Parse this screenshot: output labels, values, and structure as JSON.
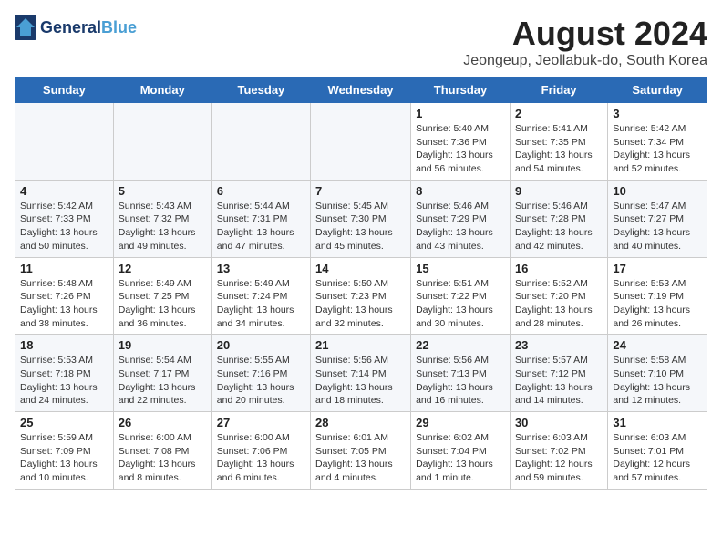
{
  "header": {
    "logo_line1": "General",
    "logo_line2": "Blue",
    "month_year": "August 2024",
    "location": "Jeongeup, Jeollabuk-do, South Korea"
  },
  "days_of_week": [
    "Sunday",
    "Monday",
    "Tuesday",
    "Wednesday",
    "Thursday",
    "Friday",
    "Saturday"
  ],
  "weeks": [
    [
      {
        "day": "",
        "info": ""
      },
      {
        "day": "",
        "info": ""
      },
      {
        "day": "",
        "info": ""
      },
      {
        "day": "",
        "info": ""
      },
      {
        "day": "1",
        "info": "Sunrise: 5:40 AM\nSunset: 7:36 PM\nDaylight: 13 hours\nand 56 minutes."
      },
      {
        "day": "2",
        "info": "Sunrise: 5:41 AM\nSunset: 7:35 PM\nDaylight: 13 hours\nand 54 minutes."
      },
      {
        "day": "3",
        "info": "Sunrise: 5:42 AM\nSunset: 7:34 PM\nDaylight: 13 hours\nand 52 minutes."
      }
    ],
    [
      {
        "day": "4",
        "info": "Sunrise: 5:42 AM\nSunset: 7:33 PM\nDaylight: 13 hours\nand 50 minutes."
      },
      {
        "day": "5",
        "info": "Sunrise: 5:43 AM\nSunset: 7:32 PM\nDaylight: 13 hours\nand 49 minutes."
      },
      {
        "day": "6",
        "info": "Sunrise: 5:44 AM\nSunset: 7:31 PM\nDaylight: 13 hours\nand 47 minutes."
      },
      {
        "day": "7",
        "info": "Sunrise: 5:45 AM\nSunset: 7:30 PM\nDaylight: 13 hours\nand 45 minutes."
      },
      {
        "day": "8",
        "info": "Sunrise: 5:46 AM\nSunset: 7:29 PM\nDaylight: 13 hours\nand 43 minutes."
      },
      {
        "day": "9",
        "info": "Sunrise: 5:46 AM\nSunset: 7:28 PM\nDaylight: 13 hours\nand 42 minutes."
      },
      {
        "day": "10",
        "info": "Sunrise: 5:47 AM\nSunset: 7:27 PM\nDaylight: 13 hours\nand 40 minutes."
      }
    ],
    [
      {
        "day": "11",
        "info": "Sunrise: 5:48 AM\nSunset: 7:26 PM\nDaylight: 13 hours\nand 38 minutes."
      },
      {
        "day": "12",
        "info": "Sunrise: 5:49 AM\nSunset: 7:25 PM\nDaylight: 13 hours\nand 36 minutes."
      },
      {
        "day": "13",
        "info": "Sunrise: 5:49 AM\nSunset: 7:24 PM\nDaylight: 13 hours\nand 34 minutes."
      },
      {
        "day": "14",
        "info": "Sunrise: 5:50 AM\nSunset: 7:23 PM\nDaylight: 13 hours\nand 32 minutes."
      },
      {
        "day": "15",
        "info": "Sunrise: 5:51 AM\nSunset: 7:22 PM\nDaylight: 13 hours\nand 30 minutes."
      },
      {
        "day": "16",
        "info": "Sunrise: 5:52 AM\nSunset: 7:20 PM\nDaylight: 13 hours\nand 28 minutes."
      },
      {
        "day": "17",
        "info": "Sunrise: 5:53 AM\nSunset: 7:19 PM\nDaylight: 13 hours\nand 26 minutes."
      }
    ],
    [
      {
        "day": "18",
        "info": "Sunrise: 5:53 AM\nSunset: 7:18 PM\nDaylight: 13 hours\nand 24 minutes."
      },
      {
        "day": "19",
        "info": "Sunrise: 5:54 AM\nSunset: 7:17 PM\nDaylight: 13 hours\nand 22 minutes."
      },
      {
        "day": "20",
        "info": "Sunrise: 5:55 AM\nSunset: 7:16 PM\nDaylight: 13 hours\nand 20 minutes."
      },
      {
        "day": "21",
        "info": "Sunrise: 5:56 AM\nSunset: 7:14 PM\nDaylight: 13 hours\nand 18 minutes."
      },
      {
        "day": "22",
        "info": "Sunrise: 5:56 AM\nSunset: 7:13 PM\nDaylight: 13 hours\nand 16 minutes."
      },
      {
        "day": "23",
        "info": "Sunrise: 5:57 AM\nSunset: 7:12 PM\nDaylight: 13 hours\nand 14 minutes."
      },
      {
        "day": "24",
        "info": "Sunrise: 5:58 AM\nSunset: 7:10 PM\nDaylight: 13 hours\nand 12 minutes."
      }
    ],
    [
      {
        "day": "25",
        "info": "Sunrise: 5:59 AM\nSunset: 7:09 PM\nDaylight: 13 hours\nand 10 minutes."
      },
      {
        "day": "26",
        "info": "Sunrise: 6:00 AM\nSunset: 7:08 PM\nDaylight: 13 hours\nand 8 minutes."
      },
      {
        "day": "27",
        "info": "Sunrise: 6:00 AM\nSunset: 7:06 PM\nDaylight: 13 hours\nand 6 minutes."
      },
      {
        "day": "28",
        "info": "Sunrise: 6:01 AM\nSunset: 7:05 PM\nDaylight: 13 hours\nand 4 minutes."
      },
      {
        "day": "29",
        "info": "Sunrise: 6:02 AM\nSunset: 7:04 PM\nDaylight: 13 hours\nand 1 minute."
      },
      {
        "day": "30",
        "info": "Sunrise: 6:03 AM\nSunset: 7:02 PM\nDaylight: 12 hours\nand 59 minutes."
      },
      {
        "day": "31",
        "info": "Sunrise: 6:03 AM\nSunset: 7:01 PM\nDaylight: 12 hours\nand 57 minutes."
      }
    ]
  ]
}
